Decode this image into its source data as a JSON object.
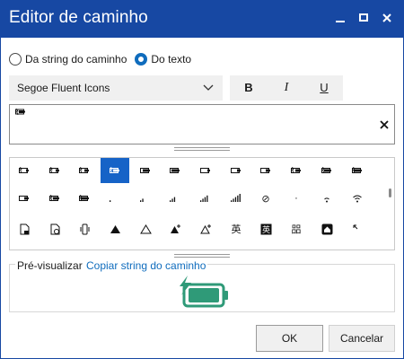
{
  "window": {
    "title": "Editor de caminho"
  },
  "titlebar_buttons": [
    {
      "name": "minimize-button",
      "glyph": "—"
    },
    {
      "name": "maximize-button",
      "glyph": "▫"
    },
    {
      "name": "close-window-button",
      "glyph": "✕"
    }
  ],
  "radios": [
    {
      "label": "Da string do caminho",
      "checked": false
    },
    {
      "label": "Do texto",
      "checked": true
    }
  ],
  "font": {
    "selected": "Segoe Fluent Icons"
  },
  "format": {
    "bold": "B",
    "italic": "I",
    "underline": "U"
  },
  "path_input": {
    "clear_glyph": "✕"
  },
  "grid": {
    "rows": [
      [
        "batt-0",
        "batt-1",
        "batt-2",
        "batt-charging-selected",
        "batt-3",
        "batt-4",
        "batt-5",
        "batt-6",
        "batt-7",
        "batt-8",
        "batt-9",
        "batt-10"
      ],
      [
        "batt-11",
        "batt-12",
        "batt-13",
        "signal-1",
        "signal-2",
        "signal-3",
        "signal-4",
        "signal-5",
        "no-signal",
        "dot",
        "wifi-1",
        "wifi-2"
      ],
      [
        "doc-lock",
        "doc-chart",
        "phone-vibrate",
        "warning-filled",
        "warning-outline",
        "warning-filled-plus",
        "warning-outline-plus",
        "ime-chinese",
        "ime-chinese-boxed",
        "ime-korean",
        "home-boxed",
        "resize-arrow"
      ]
    ],
    "glyphs": [
      [
        "",
        "",
        "",
        "",
        "",
        "",
        "",
        "",
        "",
        "",
        "",
        ""
      ],
      [
        "",
        "",
        "",
        "",
        "",
        "",
        "",
        "",
        "⊘",
        "·",
        "",
        ""
      ],
      [
        "",
        "",
        "",
        "▲",
        "△",
        "",
        "",
        "英",
        "",
        "㗊",
        "",
        ""
      ]
    ],
    "selected": [
      0,
      3
    ]
  },
  "preview": {
    "label": "Pré-visualizar",
    "link": "Copiar string do caminho",
    "color": "#2f9a78"
  },
  "actions": {
    "ok": "OK",
    "cancel": "Cancelar"
  }
}
